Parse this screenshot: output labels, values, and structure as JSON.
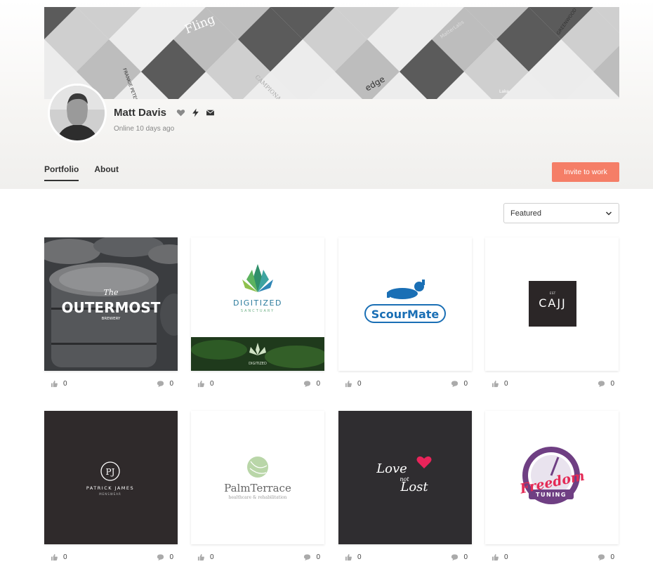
{
  "profile": {
    "name": "Matt Davis",
    "status": "Online 10 days ago"
  },
  "cover_logos": [
    "Fling",
    "MatterLabs",
    "GREENWOOD",
    "FRANKIE PETERS",
    "CAMPIONA",
    "edge",
    "Lake"
  ],
  "tabs": {
    "portfolio": "Portfolio",
    "about": "About"
  },
  "actions": {
    "invite": "Invite to work"
  },
  "sort": {
    "selected": "Featured"
  },
  "portfolio": [
    {
      "logo": "OUTERMOST",
      "logo_sub": "BREWERY",
      "logo_script": "The",
      "likes": "0",
      "comments": "0"
    },
    {
      "logo": "DIGITIZED",
      "logo_sub": "SANCTUARY",
      "likes": "0",
      "comments": "0"
    },
    {
      "logo": "ScourMate",
      "likes": "0",
      "comments": "0"
    },
    {
      "logo": "CAJJ",
      "logo_sub": "EST",
      "likes": "0",
      "comments": "0"
    },
    {
      "logo": "PJ",
      "logo_sub": "PATRICK JAMES",
      "logo_sub2": "MENSWEAR",
      "likes": "0",
      "comments": "0"
    },
    {
      "logo": "PalmTerrace",
      "logo_sub": "healthcare & rehabilitation",
      "likes": "0",
      "comments": "0"
    },
    {
      "logo": "Love",
      "logo_mid": "not",
      "logo_end": "Lost",
      "likes": "0",
      "comments": "0"
    },
    {
      "logo": "Freedom",
      "logo_sub": "TUNING",
      "likes": "0",
      "comments": "0"
    }
  ],
  "colors": {
    "accent": "#f57e67",
    "dark_tile": "#2f2a2b",
    "scourmate_blue": "#1a6fb5"
  }
}
